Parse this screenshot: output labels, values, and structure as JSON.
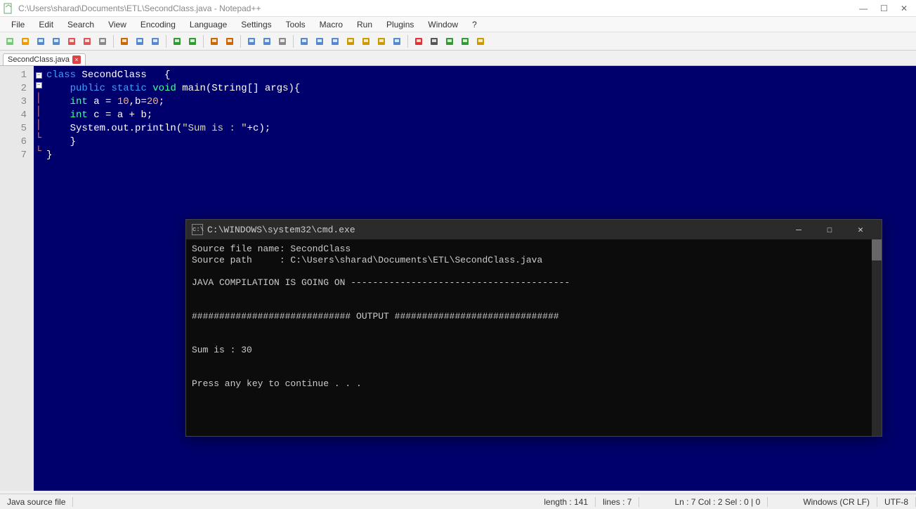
{
  "titlebar": {
    "title": "C:\\Users\\sharad\\Documents\\ETL\\SecondClass.java - Notepad++"
  },
  "menus": [
    "File",
    "Edit",
    "Search",
    "View",
    "Encoding",
    "Language",
    "Settings",
    "Tools",
    "Macro",
    "Run",
    "Plugins",
    "Window",
    "?"
  ],
  "tab": {
    "name": "SecondClass.java"
  },
  "code": {
    "line_numbers": [
      "1",
      "2",
      "3",
      "4",
      "5",
      "6",
      "7"
    ],
    "lines": [
      {
        "tokens": [
          {
            "t": "kw",
            "v": "class"
          },
          {
            "t": "punc",
            "v": " SecondClass   {"
          }
        ]
      },
      {
        "tokens": [
          {
            "t": "punc",
            "v": "    "
          },
          {
            "t": "kw",
            "v": "public"
          },
          {
            "t": "punc",
            "v": " "
          },
          {
            "t": "kw",
            "v": "static"
          },
          {
            "t": "punc",
            "v": " "
          },
          {
            "t": "type",
            "v": "void"
          },
          {
            "t": "punc",
            "v": " main(String[] args){"
          }
        ]
      },
      {
        "tokens": [
          {
            "t": "punc",
            "v": "    "
          },
          {
            "t": "type",
            "v": "int"
          },
          {
            "t": "punc",
            "v": " a = "
          },
          {
            "t": "num",
            "v": "10"
          },
          {
            "t": "punc",
            "v": ",b="
          },
          {
            "t": "num",
            "v": "20"
          },
          {
            "t": "punc",
            "v": ";"
          }
        ]
      },
      {
        "tokens": [
          {
            "t": "punc",
            "v": "    "
          },
          {
            "t": "type",
            "v": "int"
          },
          {
            "t": "punc",
            "v": " c = a + b;"
          }
        ]
      },
      {
        "tokens": [
          {
            "t": "punc",
            "v": "    System.out.println("
          },
          {
            "t": "str",
            "v": "\"Sum is : \""
          },
          {
            "t": "punc",
            "v": "+c);"
          }
        ]
      },
      {
        "tokens": [
          {
            "t": "punc",
            "v": "    }"
          }
        ]
      },
      {
        "tokens": [
          {
            "t": "punc",
            "v": "}"
          }
        ]
      }
    ]
  },
  "status": {
    "filetype": "Java source file",
    "length": "length : 141",
    "lines": "lines : 7",
    "pos": "Ln : 7    Col : 2    Sel : 0 | 0",
    "eol": "Windows (CR LF)",
    "enc": "UTF-8"
  },
  "cmd": {
    "title": "C:\\WINDOWS\\system32\\cmd.exe",
    "body": "Source file name: SecondClass\nSource path     : C:\\Users\\sharad\\Documents\\ETL\\SecondClass.java\n\nJAVA COMPILATION IS GOING ON ----------------------------------------\n\n\n############################# OUTPUT ##############################\n\n\nSum is : 30\n\n\nPress any key to continue . . ."
  },
  "toolbar_icons": [
    "new-file-icon",
    "open-file-icon",
    "save-icon",
    "save-all-icon",
    "close-icon",
    "close-all-icon",
    "print-icon",
    "cut-icon",
    "copy-icon",
    "paste-icon",
    "undo-icon",
    "redo-icon",
    "find-icon",
    "replace-icon",
    "zoom-in-icon",
    "zoom-out-icon",
    "sync-icon",
    "wordwrap-icon",
    "show-all-chars-icon",
    "indent-guide-icon",
    "folder-icon",
    "doc-map-icon",
    "func-list-icon",
    "monitor-icon",
    "record-macro-icon",
    "stop-macro-icon",
    "play-macro-icon",
    "play-multi-icon",
    "save-macro-icon"
  ]
}
